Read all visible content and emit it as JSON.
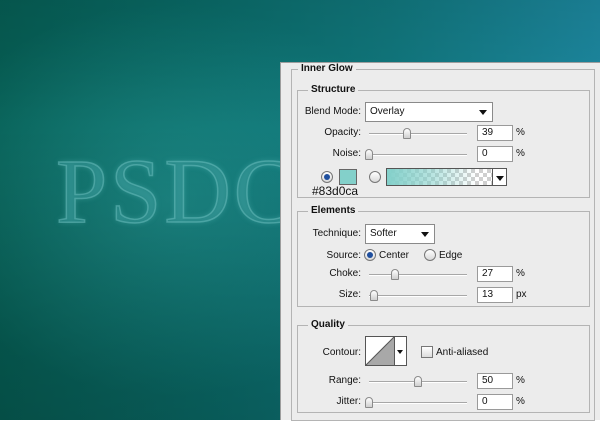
{
  "canvas": {
    "text": "PSDC"
  },
  "panel": {
    "title": "Inner Glow",
    "structure": {
      "title": "Structure",
      "blend_mode": {
        "label": "Blend Mode:",
        "value": "Overlay"
      },
      "opacity": {
        "label": "Opacity:",
        "value": "39",
        "unit": "%",
        "fraction": 0.39
      },
      "noise": {
        "label": "Noise:",
        "value": "0",
        "unit": "%",
        "fraction": 0
      },
      "glow_color": {
        "hex": "#83d0ca"
      }
    },
    "elements": {
      "title": "Elements",
      "technique": {
        "label": "Technique:",
        "value": "Softer"
      },
      "source": {
        "label": "Source:",
        "options": [
          "Center",
          "Edge"
        ],
        "selected": "Center"
      },
      "choke": {
        "label": "Choke:",
        "value": "27",
        "unit": "%",
        "fraction": 0.27
      },
      "size": {
        "label": "Size:",
        "value": "13",
        "unit": "px",
        "fraction": 0.052
      }
    },
    "quality": {
      "title": "Quality",
      "contour": {
        "label": "Contour:"
      },
      "anti_aliased": {
        "label": "Anti-aliased",
        "checked": false
      },
      "range": {
        "label": "Range:",
        "value": "50",
        "unit": "%",
        "fraction": 0.5
      },
      "jitter": {
        "label": "Jitter:",
        "value": "0",
        "unit": "%",
        "fraction": 0
      }
    }
  },
  "colors": {
    "glow": "#83d0ca",
    "panel_bg": "#ececec",
    "canvas_dark": "#065f55",
    "canvas_light": "#1d8aa2"
  }
}
